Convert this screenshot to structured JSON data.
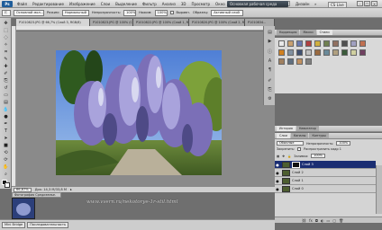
{
  "app": {
    "logo": "Ps"
  },
  "menu": [
    "Файл",
    "Редактирование",
    "Изображение",
    "Слои",
    "Выделение",
    "Фильтр",
    "Анализ",
    "3D",
    "Просмотр",
    "Окно",
    "Справка"
  ],
  "menubar_right": {
    "workspace": "Основная рабочая среда",
    "design": "Дизайн",
    "cs_live": "CS Live"
  },
  "options": {
    "tool_preset": "Основной мол...",
    "size_label": "Кисть:",
    "mode_label": "Режим:",
    "mode_value": "Нормальный",
    "opacity_label": "Непрозрачность:",
    "opacity_value": "100%",
    "flow_label": "Нажим:",
    "flow_value": "100%",
    "align_label": "Выравн.",
    "sample_label": "Образец:",
    "sample_value": "Активный слой"
  },
  "doc_tabs": [
    "P1010823.JPG @ 66,7% (Слой 3, RGB/8)",
    "P1010823.JPG @ 100% (Слой 1...",
    "P1010822.JPG @ 100% (Слой 1, RGB/8)",
    "P1010820.JPG @ 100% (Слой 2, RGB/8)",
    "P1010834..."
  ],
  "status": {
    "zoom": "66,67%",
    "doc": "Док: 14,3 М/33,8 М"
  },
  "minimized_doc": "Фотография Средиземье.",
  "bottom": {
    "minibridge": "Mini Bridge",
    "sequence": "Последовательность"
  },
  "watermark": "www.vvern.ru/nekotorye-1r-stil.html",
  "panels": {
    "top_tabs": [
      "Коррекция",
      "Маски",
      "Стили"
    ],
    "mid_tabs": [
      "История",
      "Навигатор"
    ],
    "layer_tabs": [
      "Слои",
      "Каналы",
      "Контуры"
    ]
  },
  "layers_panel": {
    "blend_mode": "Обычные",
    "opacity_label": "Непрозрачность:",
    "opacity_value": "100%",
    "lock_label": "Закрепить:",
    "unify_label": "Распространить кадр 1",
    "fill_label": "Заливка:",
    "fill_value": "100%",
    "layers": [
      {
        "name": "Слой 3",
        "active": true,
        "visible": true
      },
      {
        "name": "Слой 2",
        "active": false,
        "visible": true
      },
      {
        "name": "Слой 1",
        "active": false,
        "visible": true
      },
      {
        "name": "Слой 0",
        "active": false,
        "visible": true
      }
    ]
  },
  "colors": {
    "accent": "#1a2d72",
    "workspace": "#3a4450",
    "panel": "#d4d4d4"
  }
}
